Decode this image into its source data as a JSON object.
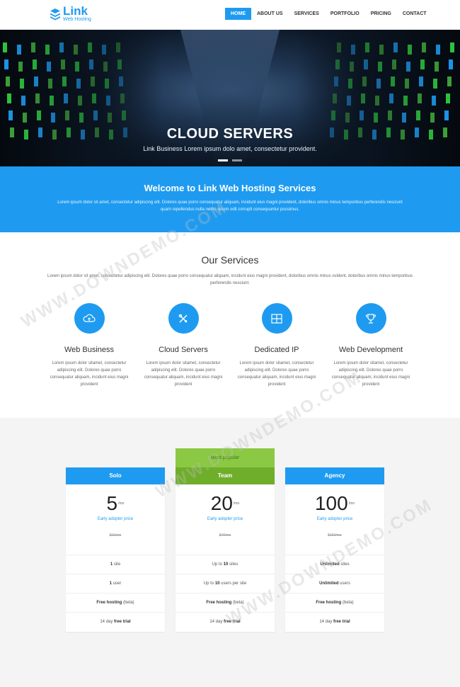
{
  "header": {
    "logo_title": "Link",
    "logo_subtitle": "Web Hosting",
    "nav": [
      "HOME",
      "ABOUT US",
      "SERVICES",
      "PORTFOLIO",
      "PRICING",
      "CONTACT"
    ],
    "active_nav": "HOME"
  },
  "hero": {
    "title": "CLOUD SERVERS",
    "subtitle": "Link Business Lorem ipsum dolo amet, consectetur provident."
  },
  "welcome": {
    "title": "Welcome to Link Web Hosting Services",
    "text": "Lorem ipsum dolor sit amet, consectetur adipiscing elit. Dolores quae porro consequatur aliquam, incidunt eius magni provident, doloribus omnis minus temporibus perferendis nesciunt quam repellendus nulla nemo ipsum odit corrupti consequuntur possimus."
  },
  "services": {
    "title": "Our Services",
    "text": "Lorem ipsum dolor sit amet, consectetur adipiscing elit. Dolores quae porro consequatur aliquam, incidunt eius magni provident, doloribus omnis minus ovident, doloribus omnis minus temporibus perferendis nesciunt.",
    "items": [
      {
        "icon": "cloud-icon",
        "title": "Web Business",
        "text": "Lorem ipsum dolor sitamet, consectetur adipiscing elit. Dolores quae porro consequatur aliquam, incidunt eius magni provident"
      },
      {
        "icon": "tools-icon",
        "title": "Cloud Servers",
        "text": "Lorem ipsum dolor sitamet, consectetur adipiscing elit. Dolores quae porro consequatur aliquam, incidunt eius magni provident"
      },
      {
        "icon": "grid-icon",
        "title": "Dedicated IP",
        "text": "Lorem ipsum dolor sitamet, consectetur adipiscing elit. Dolores quae porro consequatur aliquam, incidunt eius magni provident"
      },
      {
        "icon": "trophy-icon",
        "title": "Web Development",
        "text": "Lorem ipsum dolor sitamet, consectetur adipiscing elit. Dolores quae porro consequatur aliquam, incidunt eius magni provident"
      }
    ]
  },
  "pricing": {
    "popular_label": "Most popular",
    "plans": [
      {
        "name": "Solo",
        "price": "5",
        "unit": "/mo",
        "early": "Early adopter price",
        "old": "$15/mo",
        "f1_b": "1",
        "f1": " site",
        "f2_b": "1",
        "f2": " user",
        "f3_b": "Free hosting",
        "f3": " (beta)",
        "f4": "14 day ",
        "f4_b": "free trial"
      },
      {
        "name": "Team",
        "price": "20",
        "unit": "/mo",
        "early": "Early adopter price",
        "old": "$40/mo",
        "f1_pre": "Up to ",
        "f1_b": "10",
        "f1": " sites",
        "f2_pre": "Up to ",
        "f2_b": "10",
        "f2": " users per site",
        "f3_b": "Free hosting",
        "f3": " (beta)",
        "f4": "14 day ",
        "f4_b": "free trial"
      },
      {
        "name": "Agency",
        "price": "100",
        "unit": "/mo",
        "early": "Early adopter price",
        "old": "$150/mo",
        "f1_b": "Unlimited",
        "f1": " sites",
        "f2_b": "Unlimited",
        "f2": " users",
        "f3_b": "Free hosting",
        "f3": " (beta)",
        "f4": "14 day ",
        "f4_b": "free trial"
      }
    ]
  },
  "watermark": "WWW.DOWNDEMO.COM",
  "colors": {
    "accent": "#1e9bf0",
    "popular": "#8bc843",
    "team_head": "#6fae2a"
  }
}
